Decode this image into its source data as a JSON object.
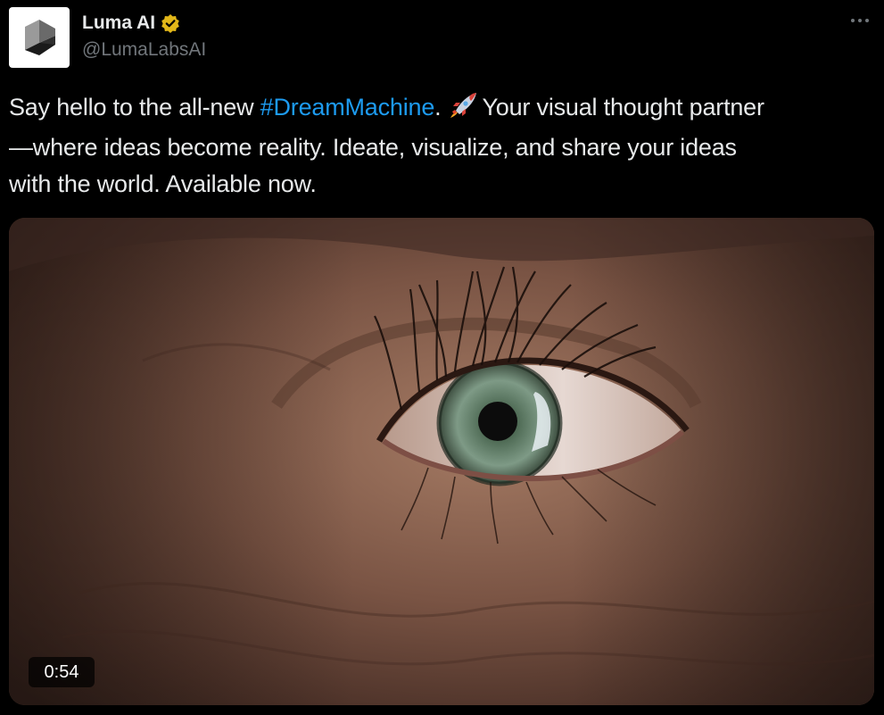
{
  "account": {
    "display_name": "Luma AI",
    "handle": "@LumaLabsAI",
    "verified": true,
    "verified_color": "#e2b719",
    "avatar_icon": "luma-cube-logo"
  },
  "tweet": {
    "line1_before": "Say hello to the all-new ",
    "hashtag": "#DreamMachine",
    "line1_after_hashtag": ".",
    "emoji_icon": "rocket-icon",
    "line1_end": "Your visual thought partner",
    "line2": "—where ideas become reality. Ideate, visualize, and share your ideas",
    "line3": "with the world. Available now."
  },
  "media": {
    "type": "video",
    "duration": "0:54"
  },
  "colors": {
    "background": "#000000",
    "text": "#e7e9ea",
    "muted": "#71767b",
    "link": "#1d9bf0"
  }
}
